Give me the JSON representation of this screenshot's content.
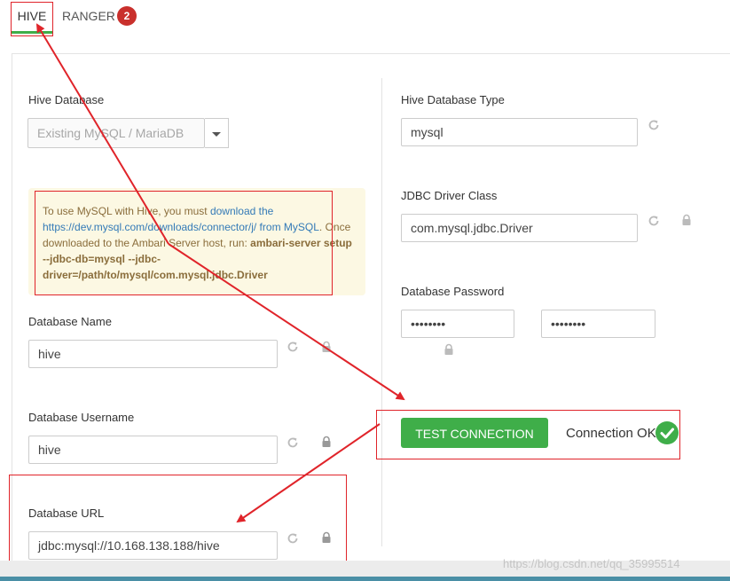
{
  "tabs": [
    {
      "label": "HIVE",
      "active": true
    },
    {
      "label": "RANGER",
      "badge": "2"
    }
  ],
  "left": {
    "hive_database_label": "Hive Database",
    "hive_database_value": "Existing MySQL / MariaDB",
    "info": {
      "text1": "To use MySQL with Hive, you must ",
      "link1": "download the https://dev.mysql.com/downloads/connector/j/ from MySQL",
      "text2": ". Once downloaded to the Ambari Server host, run: ",
      "command": "ambari-server setup --jdbc-db=mysql --jdbc-driver=/path/to/mysql/com.mysql.jdbc.Driver"
    },
    "database_name_label": "Database Name",
    "database_name_value": "hive",
    "database_username_label": "Database Username",
    "database_username_value": "hive",
    "database_url_label": "Database URL",
    "database_url_value": "jdbc:mysql://10.168.138.188/hive"
  },
  "right": {
    "db_type_label": "Hive Database Type",
    "db_type_value": "mysql",
    "jdbc_driver_label": "JDBC Driver Class",
    "jdbc_driver_value": "com.mysql.jdbc.Driver",
    "db_password_label": "Database Password",
    "db_password_value": "••••••••",
    "db_password_confirm_value": "••••••••",
    "test_button_label": "TEST CONNECTION",
    "connection_status": "Connection OK"
  },
  "watermark": "https://blog.csdn.net/qq_35995514",
  "colors": {
    "accent_green": "#3fae49",
    "badge_red": "#c9302c",
    "annotation_red": "#e0242a",
    "warning_bg": "#fcf8e3",
    "warning_text": "#8a6d3b",
    "link": "#337ab7"
  }
}
